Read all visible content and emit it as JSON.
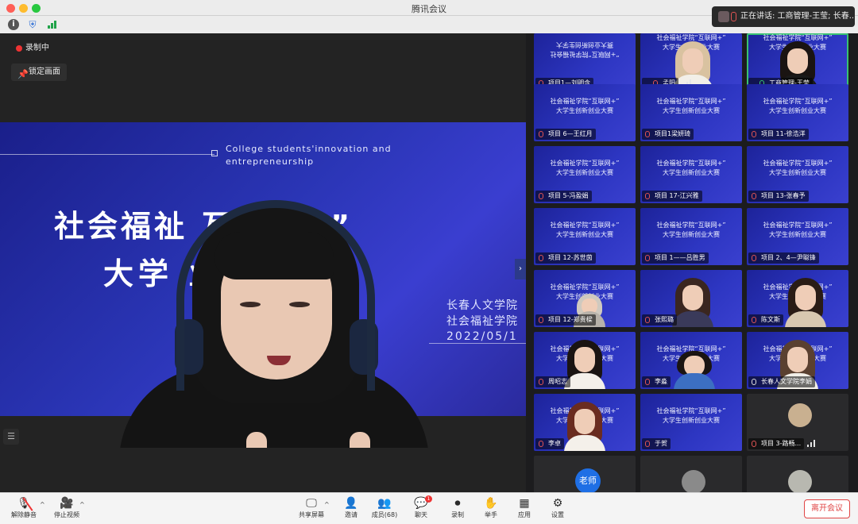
{
  "window": {
    "title": "腾讯会议"
  },
  "speaking": {
    "text": "正在讲话: 工商管理-王莹; 长春..."
  },
  "recording": {
    "label": "录制中"
  },
  "lock_view": {
    "label": "锁定画面"
  },
  "slide": {
    "english": "College students'innovation and entrepreneurship",
    "title_line1": "社会福祉      互联网+”",
    "title_line2": "大学              业大赛",
    "org1": "长春人文学院",
    "org2": "社会福祉学院",
    "date": "2022/05/1"
  },
  "tile_slide": {
    "line1": "社会福祉学院“互联网+”",
    "line2": "大学生创新创业大赛",
    "line1_flipped": "“+网联互”院学祉福会社",
    "line2_flipped": "赛大业创新创生学大"
  },
  "tiles": [
    {
      "name": "项目1—刘明含"
    },
    {
      "name": "孟阳"
    },
    {
      "name": "工商管理-王莹"
    },
    {
      "name": "项目 6—王红月"
    },
    {
      "name": "项目1梁妍琦"
    },
    {
      "name": "项目 11-徐浩洋"
    },
    {
      "name": "项目 5-冯盈娟"
    },
    {
      "name": "项目 17-江兴雅"
    },
    {
      "name": "项目 13-张春予"
    },
    {
      "name": "项目 12-苏世茵"
    },
    {
      "name": "项目 1——吕胜男"
    },
    {
      "name": "项目 2、4—尹聪锋"
    },
    {
      "name": "项目 12-郑贵樑"
    },
    {
      "name": "张熙璐"
    },
    {
      "name": "陈文斯"
    },
    {
      "name": "周昭志"
    },
    {
      "name": "李淼"
    },
    {
      "name": "长春人文学院李娟"
    },
    {
      "name": "李卓"
    },
    {
      "name": "于贺"
    },
    {
      "name": "项目 3-路畅..."
    },
    {
      "name": "老师"
    },
    {
      "name": ""
    },
    {
      "name": ""
    }
  ],
  "toolbar": {
    "unmute": "解除静音",
    "stop_video": "停止视频",
    "share": "共享屏幕",
    "invite": "邀请",
    "members": "成员(68)",
    "chat": "聊天",
    "chat_badge": "1",
    "record": "录制",
    "raise_hand": "举手",
    "apps": "应用",
    "settings": "设置",
    "leave": "离开会议"
  },
  "colors": {
    "accent_green": "#38c172",
    "leave_red": "#e04545",
    "slide_blue": "#2a35b5"
  }
}
